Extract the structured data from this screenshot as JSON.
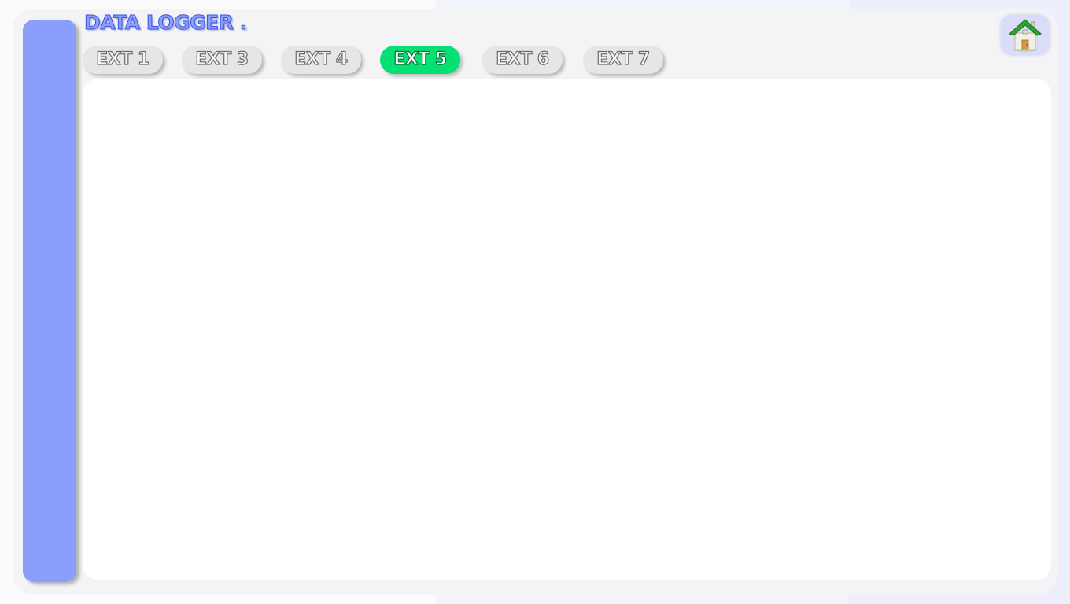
{
  "app": {
    "title": "DATA LOGGER ."
  },
  "tabs": [
    {
      "label": "EXT 1",
      "active": false
    },
    {
      "label": "EXT 3",
      "active": false
    },
    {
      "label": "EXT 4",
      "active": false
    },
    {
      "label": "EXT 5",
      "active": true
    },
    {
      "label": "EXT 6",
      "active": false
    },
    {
      "label": "EXT 7",
      "active": false
    }
  ],
  "icons": {
    "home": "home-icon"
  },
  "colors": {
    "accent": "#8a9efb",
    "accent_stroke": "#3a52e8",
    "active_tab": "#05e072",
    "inactive_tab": "#e6e6e8",
    "home_button_bg": "#d9ddfa"
  }
}
